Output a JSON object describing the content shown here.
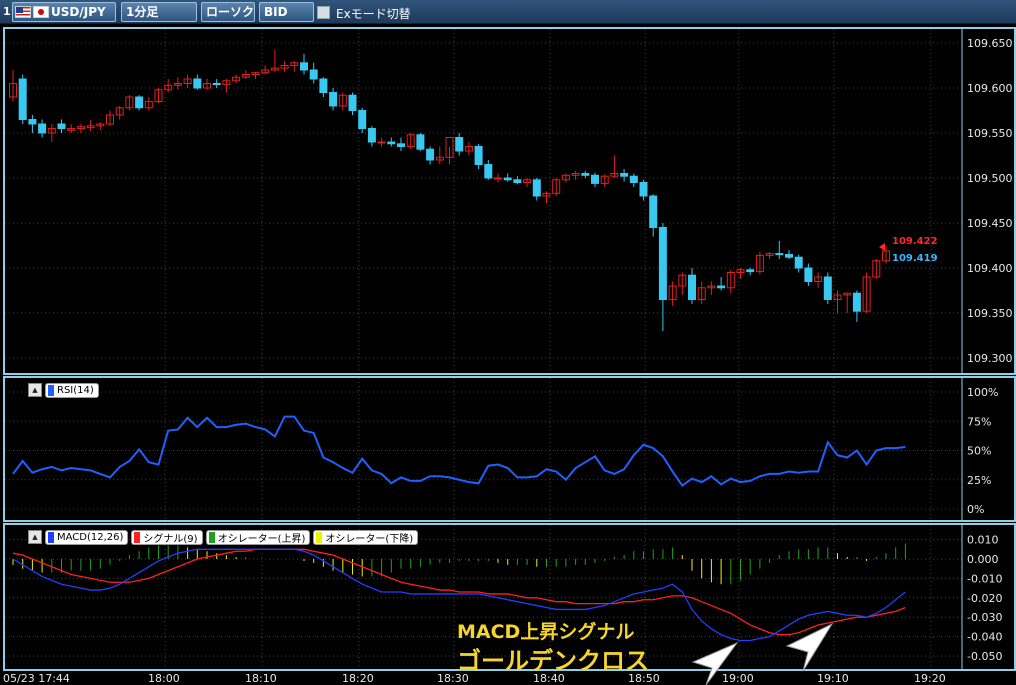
{
  "toolbar": {
    "index": "1:",
    "pair": "USD/JPY",
    "timeframe": "1分足",
    "chart_type": "ローソク",
    "price_type": "BID",
    "ex_mode": "Exモード切替"
  },
  "price_axis": [
    "109.650",
    "109.600",
    "109.550",
    "109.500",
    "109.450",
    "109.400",
    "109.350",
    "109.300"
  ],
  "rsi_axis": [
    "100%",
    "75%",
    "50%",
    "25%",
    "0%"
  ],
  "macd_axis": [
    "0.010",
    "0.000",
    "-0.010",
    "-0.020",
    "-0.030",
    "-0.040",
    "-0.050"
  ],
  "time_axis": [
    "05/23 17:44",
    "18:00",
    "18:10",
    "18:20",
    "18:30",
    "18:40",
    "18:50",
    "19:00",
    "19:10",
    "19:20"
  ],
  "current_ask": "109.422",
  "current_bid": "109.419",
  "legend": {
    "rsi": "RSI(14)",
    "macd": "MACD(12,26)",
    "signal": "シグナル(9)",
    "osc_up": "オシレーター(上昇)",
    "osc_down": "オシレーター(下降)"
  },
  "annotation": {
    "line1": "MACD上昇シグナル",
    "line2": "ゴールデンクロス"
  },
  "colors": {
    "up_candle": "#e02020",
    "down_candle": "#38c8f0",
    "rsi_line": "#2060ff",
    "macd_line": "#2040ff",
    "signal_line": "#ff2020",
    "osc_up": "#20a020",
    "osc_down": "#f0f000",
    "annotation": "#f6d52c"
  },
  "chart_data": [
    {
      "type": "candlestick",
      "ylim": [
        109.3,
        109.65
      ],
      "ohlc": [
        [
          109.59,
          109.62,
          109.585,
          109.605
        ],
        [
          109.61,
          109.615,
          109.56,
          109.565
        ],
        [
          109.565,
          109.57,
          109.55,
          109.56
        ],
        [
          109.56,
          109.565,
          109.545,
          109.55
        ],
        [
          109.55,
          109.56,
          109.54,
          109.555
        ],
        [
          109.56,
          109.565,
          109.55,
          109.555
        ],
        [
          109.553,
          109.56,
          109.55,
          109.555
        ],
        [
          109.555,
          109.56,
          109.55,
          109.557
        ],
        [
          109.556,
          109.565,
          109.552,
          109.558
        ],
        [
          109.558,
          109.562,
          109.553,
          109.56
        ],
        [
          109.56,
          109.575,
          109.558,
          109.57
        ],
        [
          109.57,
          109.58,
          109.565,
          109.578
        ],
        [
          109.578,
          109.592,
          109.575,
          109.59
        ],
        [
          109.59,
          109.592,
          109.575,
          109.578
        ],
        [
          109.578,
          109.59,
          109.575,
          109.585
        ],
        [
          109.585,
          109.6,
          109.583,
          109.598
        ],
        [
          109.598,
          109.61,
          109.595,
          109.603
        ],
        [
          109.603,
          109.612,
          109.598,
          109.605
        ],
        [
          109.605,
          109.615,
          109.6,
          109.61
        ],
        [
          109.61,
          109.615,
          109.598,
          109.6
        ],
        [
          109.6,
          109.61,
          109.598,
          109.605
        ],
        [
          109.605,
          109.61,
          109.6,
          109.604
        ],
        [
          109.604,
          109.61,
          109.595,
          109.608
        ],
        [
          109.608,
          109.615,
          109.605,
          109.612
        ],
        [
          109.612,
          109.62,
          109.61,
          109.615
        ],
        [
          109.615,
          109.618,
          109.61,
          109.617
        ],
        [
          109.617,
          109.625,
          109.615,
          109.62
        ],
        [
          109.62,
          109.643,
          109.618,
          109.622
        ],
        [
          109.622,
          109.63,
          109.618,
          109.625
        ],
        [
          109.625,
          109.63,
          109.618,
          109.628
        ],
        [
          109.628,
          109.638,
          109.615,
          109.62
        ],
        [
          109.62,
          109.628,
          109.605,
          109.61
        ],
        [
          109.61,
          109.612,
          109.59,
          109.595
        ],
        [
          109.595,
          109.6,
          109.575,
          109.58
        ],
        [
          109.58,
          109.595,
          109.575,
          109.592
        ],
        [
          109.592,
          109.595,
          109.57,
          109.575
        ],
        [
          109.575,
          109.578,
          109.55,
          109.555
        ],
        [
          109.555,
          109.558,
          109.535,
          109.54
        ],
        [
          109.54,
          109.545,
          109.535,
          109.54
        ],
        [
          109.54,
          109.545,
          109.535,
          109.538
        ],
        [
          109.538,
          109.545,
          109.53,
          109.535
        ],
        [
          109.535,
          109.55,
          109.532,
          109.548
        ],
        [
          109.548,
          109.55,
          109.53,
          109.532
        ],
        [
          109.532,
          109.535,
          109.515,
          109.52
        ],
        [
          109.52,
          109.535,
          109.515,
          109.523
        ],
        [
          109.523,
          109.535,
          109.515,
          109.545
        ],
        [
          109.545,
          109.55,
          109.525,
          109.53
        ],
        [
          109.53,
          109.54,
          109.525,
          109.535
        ],
        [
          109.535,
          109.538,
          109.51,
          109.515
        ],
        [
          109.515,
          109.52,
          109.498,
          109.5
        ],
        [
          109.5,
          109.505,
          109.495,
          109.5
        ],
        [
          109.5,
          109.505,
          109.496,
          109.498
        ],
        [
          109.498,
          109.502,
          109.493,
          109.495
        ],
        [
          109.495,
          109.5,
          109.49,
          109.498
        ],
        [
          109.498,
          109.5,
          109.475,
          109.48
        ],
        [
          109.48,
          109.485,
          109.472,
          109.483
        ],
        [
          109.483,
          109.5,
          109.48,
          109.498
        ],
        [
          109.498,
          109.505,
          109.495,
          109.503
        ],
        [
          109.503,
          109.508,
          109.498,
          109.505
        ],
        [
          109.505,
          109.508,
          109.5,
          109.503
        ],
        [
          109.503,
          109.506,
          109.49,
          109.494
        ],
        [
          109.494,
          109.504,
          109.49,
          109.502
        ],
        [
          109.502,
          109.525,
          109.5,
          109.505
        ],
        [
          109.505,
          109.51,
          109.496,
          109.502
        ],
        [
          109.502,
          109.505,
          109.49,
          109.495
        ],
        [
          109.495,
          109.498,
          109.475,
          109.48
        ],
        [
          109.48,
          109.482,
          109.435,
          109.445
        ],
        [
          109.445,
          109.45,
          109.33,
          109.365
        ],
        [
          109.365,
          109.385,
          109.358,
          109.38
        ],
        [
          109.38,
          109.395,
          109.37,
          109.392
        ],
        [
          109.392,
          109.4,
          109.36,
          109.365
        ],
        [
          109.365,
          109.385,
          109.36,
          109.378
        ],
        [
          109.378,
          109.385,
          109.37,
          109.38
        ],
        [
          109.38,
          109.39,
          109.375,
          109.378
        ],
        [
          109.378,
          109.398,
          109.372,
          109.395
        ],
        [
          109.395,
          109.4,
          109.388,
          109.398
        ],
        [
          109.398,
          109.4,
          109.392,
          109.396
        ],
        [
          109.396,
          109.418,
          109.393,
          109.414
        ],
        [
          109.414,
          109.418,
          109.41,
          109.416
        ],
        [
          109.416,
          109.43,
          109.41,
          109.415
        ],
        [
          109.415,
          109.42,
          109.41,
          109.412
        ],
        [
          109.412,
          109.415,
          109.395,
          109.4
        ],
        [
          109.4,
          109.405,
          109.38,
          109.385
        ],
        [
          109.385,
          109.395,
          109.378,
          109.39
        ],
        [
          109.39,
          109.395,
          109.36,
          109.365
        ],
        [
          109.365,
          109.375,
          109.35,
          109.37
        ],
        [
          109.37,
          109.372,
          109.35,
          109.372
        ],
        [
          109.372,
          109.375,
          109.34,
          109.352
        ],
        [
          109.352,
          109.395,
          109.35,
          109.39
        ],
        [
          109.39,
          109.41,
          109.388,
          109.408
        ],
        [
          109.408,
          109.425,
          109.405,
          109.419
        ]
      ]
    },
    {
      "type": "line",
      "name": "RSI(14)",
      "ylim": [
        0,
        100
      ],
      "values": [
        30,
        41,
        31,
        34,
        36,
        33,
        35,
        34,
        33,
        30,
        27,
        36,
        41,
        51,
        40,
        38,
        67,
        68,
        78,
        70,
        78,
        70,
        70,
        72,
        73,
        70,
        68,
        62,
        79,
        79,
        67,
        65,
        44,
        40,
        35,
        31,
        43,
        33,
        30,
        22,
        27,
        24,
        24,
        28,
        28,
        27,
        25,
        23,
        22,
        37,
        38,
        35,
        27,
        27,
        28,
        34,
        32,
        25,
        35,
        40,
        45,
        33,
        30,
        34,
        46,
        55,
        52,
        45,
        32,
        20,
        26,
        23,
        28,
        21,
        26,
        23,
        24,
        28,
        30,
        30,
        32,
        31,
        32,
        32,
        57,
        46,
        44,
        50,
        38,
        50,
        52,
        52,
        53
      ],
      "ticks": [
        "100%",
        "75%",
        "50%",
        "25%",
        "0%"
      ]
    },
    {
      "type": "line",
      "name": "MACD(12,26)",
      "ylim": [
        -0.055,
        0.012
      ],
      "series": [
        {
          "name": "MACD(12,26)",
          "values": [
            0.0,
            -0.003,
            -0.006,
            -0.009,
            -0.011,
            -0.013,
            -0.014,
            -0.015,
            -0.016,
            -0.016,
            -0.015,
            -0.013,
            -0.01,
            -0.007,
            -0.004,
            -0.001,
            0.001,
            0.003,
            0.004,
            0.005,
            0.005,
            0.005,
            0.005,
            0.005,
            0.005,
            0.005,
            0.005,
            0.005,
            0.005,
            0.005,
            0.004,
            0.002,
            -0.001,
            -0.004,
            -0.007,
            -0.01,
            -0.013,
            -0.015,
            -0.017,
            -0.017,
            -0.017,
            -0.018,
            -0.018,
            -0.018,
            -0.018,
            -0.018,
            -0.018,
            -0.018,
            -0.018,
            -0.019,
            -0.02,
            -0.021,
            -0.022,
            -0.023,
            -0.024,
            -0.025,
            -0.026,
            -0.026,
            -0.026,
            -0.026,
            -0.025,
            -0.024,
            -0.022,
            -0.02,
            -0.018,
            -0.017,
            -0.016,
            -0.015,
            -0.013,
            -0.017,
            -0.026,
            -0.032,
            -0.036,
            -0.039,
            -0.041,
            -0.042,
            -0.042,
            -0.041,
            -0.04,
            -0.037,
            -0.034,
            -0.031,
            -0.029,
            -0.028,
            -0.027,
            -0.028,
            -0.029,
            -0.029,
            -0.03,
            -0.028,
            -0.025,
            -0.021,
            -0.017
          ]
        },
        {
          "name": "シグナル(9)",
          "values": [
            0.003,
            0.002,
            0.0,
            -0.002,
            -0.004,
            -0.006,
            -0.008,
            -0.009,
            -0.01,
            -0.011,
            -0.012,
            -0.012,
            -0.012,
            -0.011,
            -0.01,
            -0.008,
            -0.006,
            -0.004,
            -0.002,
            0.0,
            0.001,
            0.002,
            0.003,
            0.004,
            0.004,
            0.005,
            0.005,
            0.005,
            0.005,
            0.005,
            0.005,
            0.004,
            0.003,
            0.002,
            0.0,
            -0.002,
            -0.004,
            -0.006,
            -0.008,
            -0.01,
            -0.012,
            -0.013,
            -0.014,
            -0.015,
            -0.016,
            -0.016,
            -0.017,
            -0.017,
            -0.017,
            -0.018,
            -0.018,
            -0.018,
            -0.019,
            -0.02,
            -0.02,
            -0.021,
            -0.022,
            -0.022,
            -0.023,
            -0.023,
            -0.023,
            -0.023,
            -0.023,
            -0.022,
            -0.022,
            -0.021,
            -0.021,
            -0.02,
            -0.019,
            -0.019,
            -0.02,
            -0.022,
            -0.024,
            -0.026,
            -0.028,
            -0.031,
            -0.034,
            -0.036,
            -0.038,
            -0.039,
            -0.039,
            -0.038,
            -0.036,
            -0.034,
            -0.033,
            -0.032,
            -0.031,
            -0.03,
            -0.03,
            -0.029,
            -0.028,
            -0.027,
            -0.025
          ]
        },
        {
          "name": "オシレーター",
          "values": [
            -0.003,
            -0.005,
            -0.006,
            -0.007,
            -0.007,
            -0.007,
            -0.006,
            -0.006,
            -0.006,
            -0.005,
            -0.003,
            -0.001,
            0.002,
            0.004,
            0.006,
            0.007,
            0.007,
            0.007,
            0.006,
            0.005,
            0.004,
            0.003,
            0.002,
            0.001,
            0.001,
            0.0,
            0.0,
            0.0,
            0.0,
            0.0,
            -0.001,
            -0.002,
            -0.004,
            -0.006,
            -0.007,
            -0.008,
            -0.009,
            -0.009,
            -0.009,
            -0.007,
            -0.005,
            -0.005,
            -0.004,
            -0.003,
            -0.002,
            -0.002,
            -0.001,
            -0.001,
            -0.001,
            -0.001,
            -0.002,
            -0.003,
            -0.003,
            -0.003,
            -0.004,
            -0.004,
            -0.004,
            -0.004,
            -0.003,
            -0.003,
            -0.002,
            -0.001,
            0.001,
            0.002,
            0.004,
            0.004,
            0.005,
            0.005,
            0.006,
            0.002,
            -0.006,
            -0.01,
            -0.012,
            -0.013,
            -0.013,
            -0.011,
            -0.008,
            -0.005,
            -0.002,
            0.002,
            0.004,
            0.005,
            0.005,
            0.006,
            0.006,
            0.003,
            0.001,
            0.001,
            -0.001,
            0.001,
            0.003,
            0.006,
            0.008
          ]
        }
      ]
    }
  ]
}
